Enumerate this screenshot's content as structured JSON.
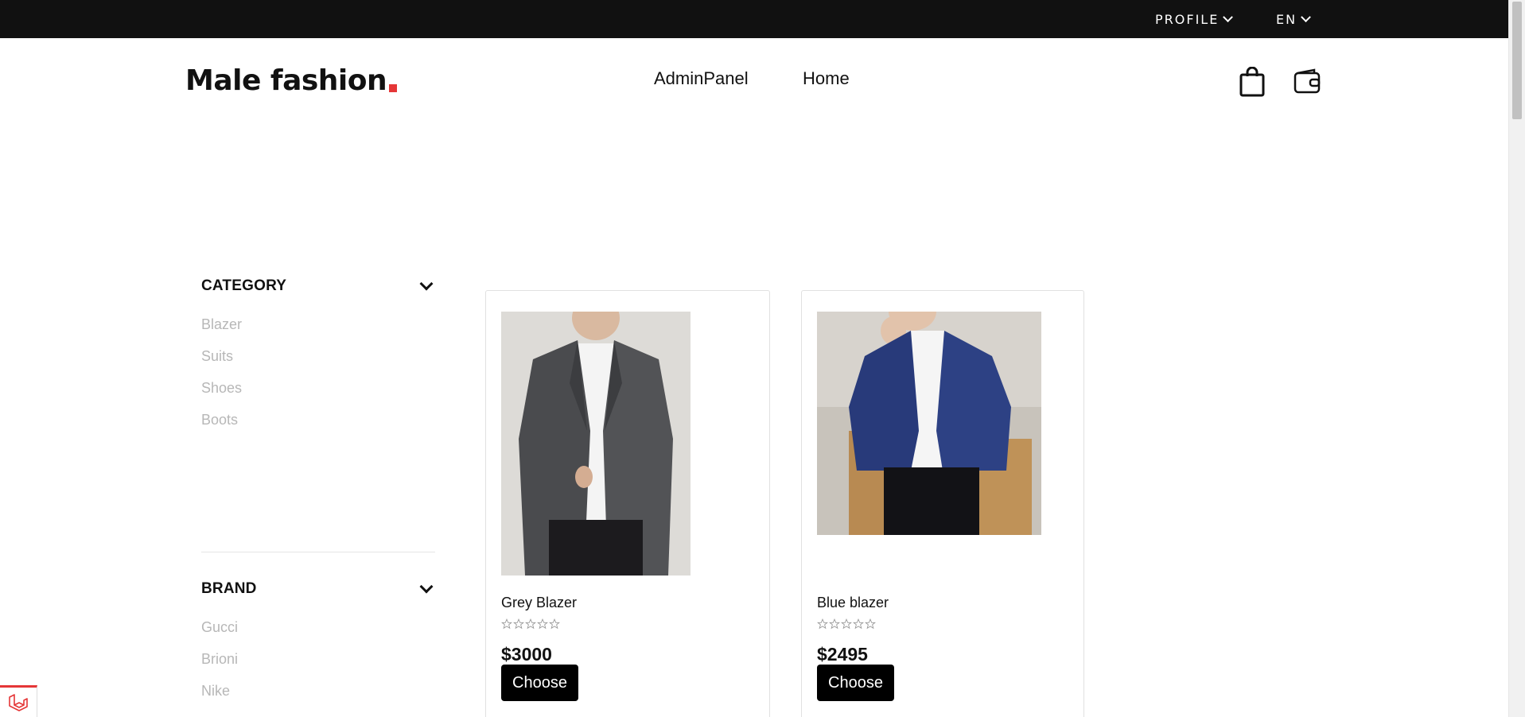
{
  "topbar": {
    "profile_label": "PROFILE",
    "lang_label": "EN"
  },
  "header": {
    "logo_text": "Male fashion",
    "logo_dot_color": "#e53637",
    "nav": [
      {
        "label": "AdminPanel"
      },
      {
        "label": "Home"
      }
    ],
    "icons": [
      "shopping-bag-icon",
      "wallet-icon"
    ]
  },
  "sidebar": {
    "category": {
      "title": "CATEGORY",
      "items": [
        "Blazer",
        "Suits",
        "Shoes",
        "Boots"
      ]
    },
    "brand": {
      "title": "BRAND",
      "items": [
        "Gucci",
        "Brioni",
        "Nike"
      ]
    }
  },
  "products": [
    {
      "name": "Grey Blazer",
      "price": "$3000",
      "rating": 0,
      "button": "Choose",
      "image": "grey-blazer-photo"
    },
    {
      "name": "Blue blazer",
      "price": "$2495",
      "rating": 0,
      "button": "Choose",
      "image": "blue-blazer-photo"
    }
  ],
  "colors": {
    "topbar_bg": "#111111",
    "accent": "#e53637",
    "muted_text": "#b7b7b7",
    "button_bg": "#000000"
  }
}
